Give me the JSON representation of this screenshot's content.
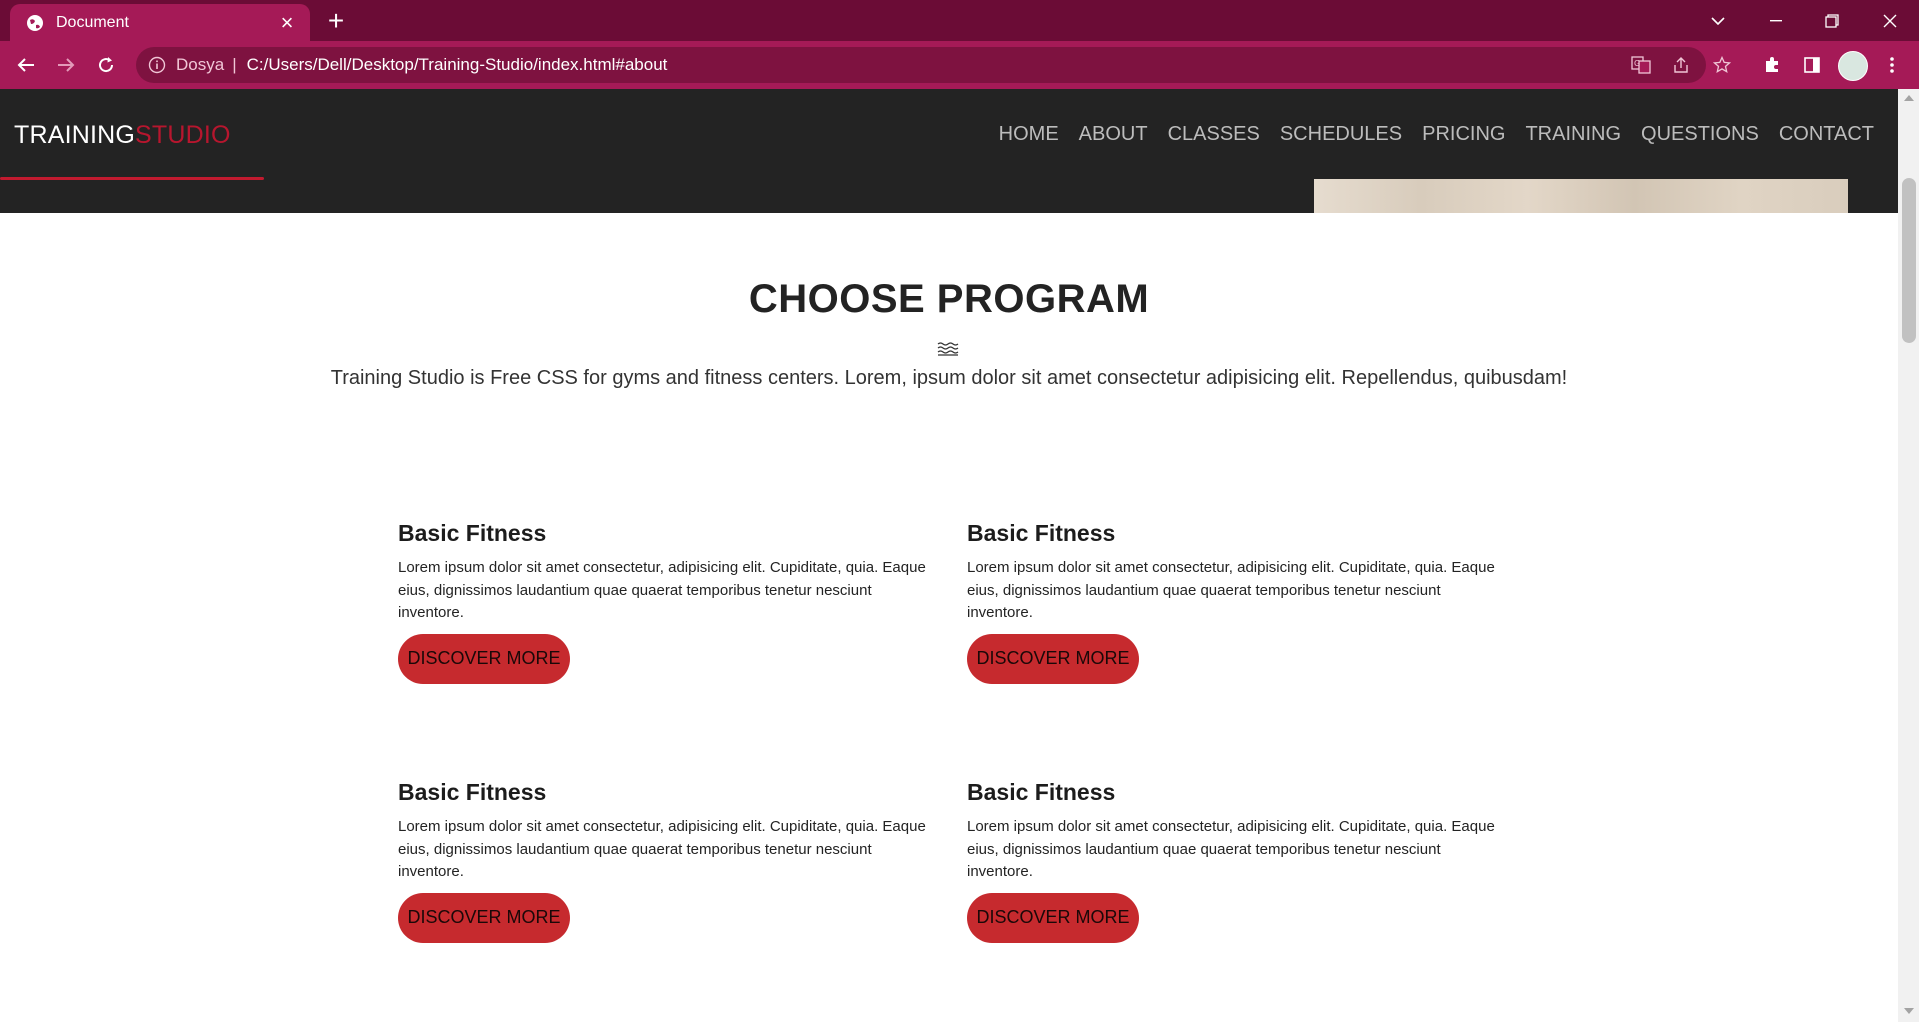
{
  "browser": {
    "tab_title": "Document",
    "address_site": "Dosya",
    "address_url": "C:/Users/Dell/Desktop/Training-Studio/index.html#about",
    "colors": {
      "titlebar": "#6b0c36",
      "toolbar": "#a51a57"
    }
  },
  "header": {
    "logo_part1": "TRAINING",
    "logo_part2": "STUDIO",
    "nav": [
      {
        "label": "HOME"
      },
      {
        "label": "ABOUT"
      },
      {
        "label": "CLASSES"
      },
      {
        "label": "SCHEDULES"
      },
      {
        "label": "PRICING"
      },
      {
        "label": "TRAINING"
      },
      {
        "label": "QUESTIONS"
      },
      {
        "label": "CONTACT"
      }
    ]
  },
  "section": {
    "title": "CHOOSE PROGRAM",
    "description": "Training Studio is Free CSS for gyms and fitness centers. Lorem, ipsum dolor sit amet consectetur adipisicing elit. Repellendus, quibusdam!"
  },
  "programs": [
    {
      "title": "Basic Fitness",
      "text": "Lorem ipsum dolor sit amet consectetur, adipisicing elit. Cupiditate, quia. Eaque eius, dignissimos laudantium quae quaerat temporibus tenetur nesciunt inventore.",
      "button": "DISCOVER MORE"
    },
    {
      "title": "Basic Fitness",
      "text": "Lorem ipsum dolor sit amet consectetur, adipisicing elit. Cupiditate, quia. Eaque eius, dignissimos laudantium quae quaerat temporibus tenetur nesciunt inventore.",
      "button": "DISCOVER MORE"
    },
    {
      "title": "Basic Fitness",
      "text": "Lorem ipsum dolor sit amet consectetur, adipisicing elit. Cupiditate, quia. Eaque eius, dignissimos laudantium quae quaerat temporibus tenetur nesciunt inventore.",
      "button": "DISCOVER MORE"
    },
    {
      "title": "Basic Fitness",
      "text": "Lorem ipsum dolor sit amet consectetur, adipisicing elit. Cupiditate, quia. Eaque eius, dignissimos laudantium quae quaerat temporibus tenetur nesciunt inventore.",
      "button": "DISCOVER MORE"
    }
  ],
  "colors": {
    "accent": "#c62a2e",
    "header_bg": "#232323"
  }
}
